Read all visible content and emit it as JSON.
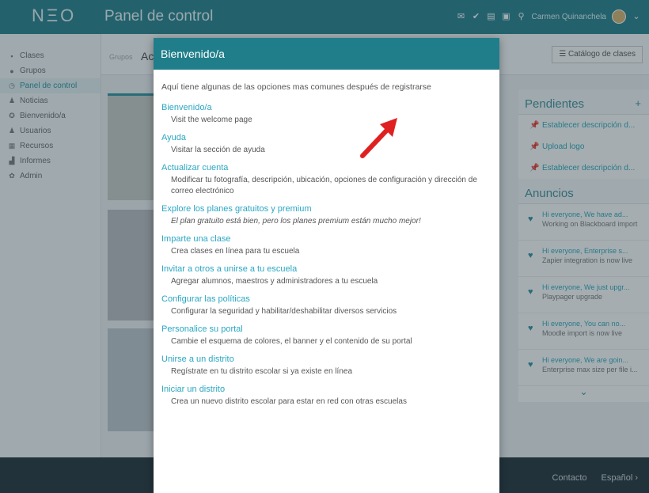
{
  "topbar": {
    "logo": "NΞO",
    "title": "Panel de control",
    "username": "Carmen Quinanchela"
  },
  "sidebar": {
    "items": [
      {
        "label": "Clases",
        "icon": "book-icon",
        "glyph": "▪"
      },
      {
        "label": "Grupos",
        "icon": "group-icon",
        "glyph": "●"
      },
      {
        "label": "Panel de control",
        "icon": "dashboard-icon",
        "glyph": "◷"
      },
      {
        "label": "Noticias",
        "icon": "news-icon",
        "glyph": "♟"
      },
      {
        "label": "Bienvenido/a",
        "icon": "welcome-icon",
        "glyph": "✪"
      },
      {
        "label": "Usuarios",
        "icon": "users-icon",
        "glyph": "♟"
      },
      {
        "label": "Recursos",
        "icon": "resources-icon",
        "glyph": "▦"
      },
      {
        "label": "Informes",
        "icon": "reports-icon",
        "glyph": "▟"
      },
      {
        "label": "Admin",
        "icon": "admin-gear-icon",
        "glyph": "✿"
      }
    ]
  },
  "main": {
    "tab_small": "Grupos",
    "tab_big": "Ac",
    "catalog_button": "Catálogo de clases"
  },
  "right": {
    "pending_title": "Pendientes",
    "pending_items": [
      "Establecer descripción d...",
      "Upload logo",
      "Establecer descripción d..."
    ],
    "ann_title": "Anuncios",
    "announcements": [
      {
        "t1": "Hi everyone, We have ad...",
        "t2": "Working on Blackboard import"
      },
      {
        "t1": "Hi everyone, Enterprise s...",
        "t2": "Zapier integration is now live"
      },
      {
        "t1": "Hi everyone, We just upgr...",
        "t2": "Playpager upgrade"
      },
      {
        "t1": "Hi everyone, You can no...",
        "t2": "Moodle import is now live"
      },
      {
        "t1": "Hi everyone, We are goin...",
        "t2": "Enterprise max size per file i..."
      }
    ]
  },
  "footer": {
    "contact": "Contacto",
    "language": "Español ›"
  },
  "modal": {
    "title": "Bienvenido/a",
    "intro": "Aquí tiene algunas de las opciones mas comunes después de registrarse",
    "options": [
      {
        "title": "Bienvenido/a",
        "desc": "Visit the welcome page"
      },
      {
        "title": "Ayuda",
        "desc": "Visitar la sección de ayuda"
      },
      {
        "title": "Actualizar cuenta",
        "desc": "Modificar tu fotografía, descripción, ubicación, opciones de configuración y dirección de correo electrónico"
      },
      {
        "title": "Explore los planes gratuitos y premium",
        "desc": "El plan gratuito está bien, pero los planes premium están mucho mejor!"
      },
      {
        "title": "Imparte una clase",
        "desc": "Crea clases en línea para tu escuela"
      },
      {
        "title": "Invitar a otros a unirse a tu escuela",
        "desc": "Agregar alumnos, maestros y administradores a tu escuela"
      },
      {
        "title": "Configurar las políticas",
        "desc": "Configurar la seguridad y habilitar/deshabilitar diversos servicios"
      },
      {
        "title": "Personalice su portal",
        "desc": "Cambie el esquema de colores, el banner y el contenido de su portal"
      },
      {
        "title": "Unirse a un distrito",
        "desc": "Regístrate en tu distrito escolar si ya existe en línea"
      },
      {
        "title": "Iniciar un distrito",
        "desc": "Crea un nuevo distrito escolar para estar en red con otras escuelas"
      }
    ]
  },
  "colors": {
    "brand": "#1f7e8a",
    "link": "#2aa7c3",
    "arrow": "#e02020"
  }
}
